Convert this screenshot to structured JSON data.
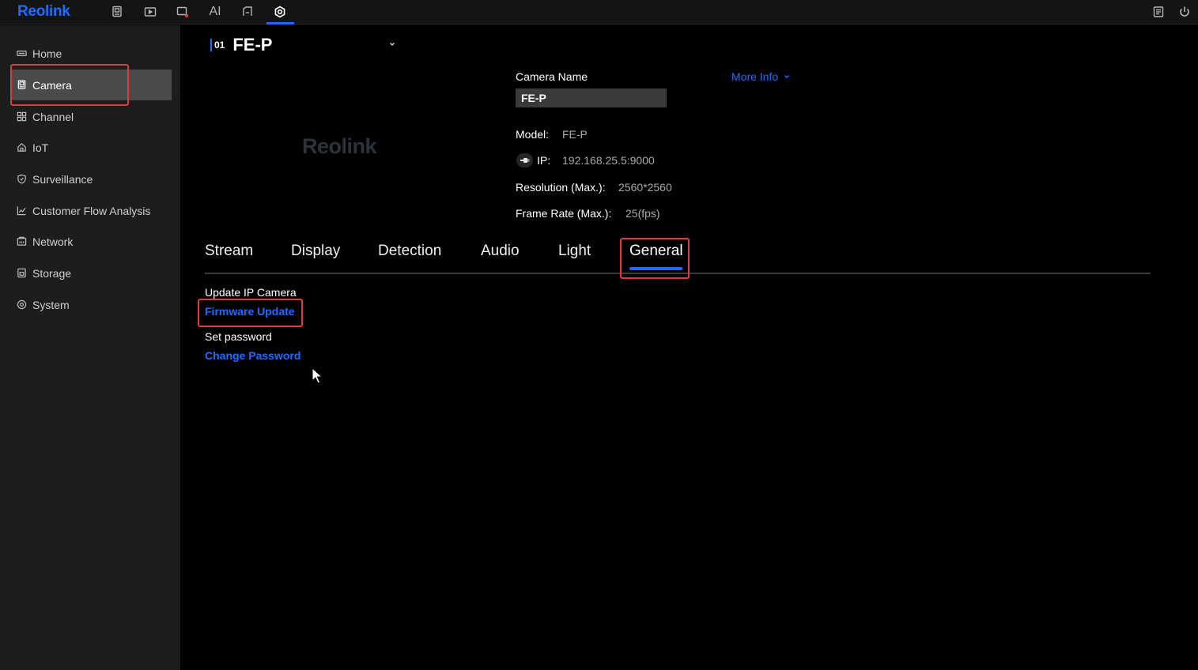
{
  "app": {
    "logo": "Reolink"
  },
  "topbar": {
    "ai_label": "AI",
    "icons": [
      "monitor-icon",
      "playback-icon",
      "alarm-icon",
      "ai-icon",
      "device-icon",
      "settings-icon",
      "log-icon",
      "power-icon"
    ]
  },
  "sidebar": {
    "items": [
      {
        "label": "Home",
        "icon": "home-icon"
      },
      {
        "label": "Camera",
        "icon": "camera-icon"
      },
      {
        "label": "Channel",
        "icon": "channel-icon"
      },
      {
        "label": "IoT",
        "icon": "iot-icon"
      },
      {
        "label": "Surveillance",
        "icon": "shield-icon"
      },
      {
        "label": "Customer Flow Analysis",
        "icon": "chart-icon"
      },
      {
        "label": "Network",
        "icon": "network-icon"
      },
      {
        "label": "Storage",
        "icon": "storage-icon"
      },
      {
        "label": "System",
        "icon": "system-icon"
      }
    ],
    "active": "Camera"
  },
  "camera": {
    "number": "01",
    "title": "FE-P",
    "preview_logo": "Reolink",
    "name_label": "Camera Name",
    "name_value": "FE-P",
    "more_info": "More Info",
    "model_label": "Model:",
    "model_value": "FE-P",
    "ip_label": "IP:",
    "ip_value": "192.168.25.5:9000",
    "resolution_label": "Resolution (Max.):",
    "resolution_value": "2560*2560",
    "framerate_label": "Frame Rate (Max.):",
    "framerate_value": "25(fps)"
  },
  "tabs": [
    {
      "label": "Stream"
    },
    {
      "label": "Display"
    },
    {
      "label": "Detection"
    },
    {
      "label": "Audio"
    },
    {
      "label": "Light"
    },
    {
      "label": "General"
    }
  ],
  "active_tab": "General",
  "general": {
    "update_label": "Update IP Camera",
    "firmware_link": "Firmware Update",
    "password_label": "Set password",
    "password_link": "Change Password"
  },
  "colors": {
    "accent": "#1f6bff",
    "highlight": "#e03a3a",
    "sidebar_bg": "#1d1d1d",
    "active_item": "#4a4a4a"
  }
}
